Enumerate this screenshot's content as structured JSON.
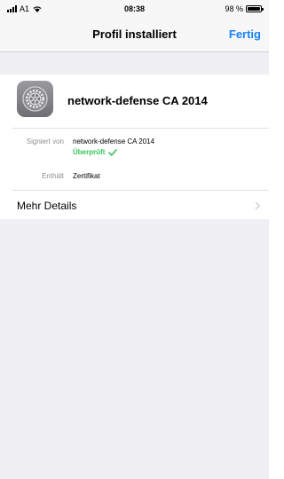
{
  "status_bar": {
    "carrier": "A1",
    "time": "08:38",
    "battery": "98 %",
    "battery_level": 0.98
  },
  "nav": {
    "title": "Profil installiert",
    "done_label": "Fertig"
  },
  "profile": {
    "name": "network-defense CA 2014",
    "icon": "settings-gear-icon",
    "signed_by_label": "Signiert von",
    "signed_by_value": "network-defense CA 2014",
    "verified_label": "Überprüft",
    "contains_label": "Enthält",
    "contains_value": "Zertifikat",
    "more_details_label": "Mehr Details"
  },
  "colors": {
    "accent": "#1a82fb",
    "verified": "#37c559",
    "background": "#efeff4"
  }
}
